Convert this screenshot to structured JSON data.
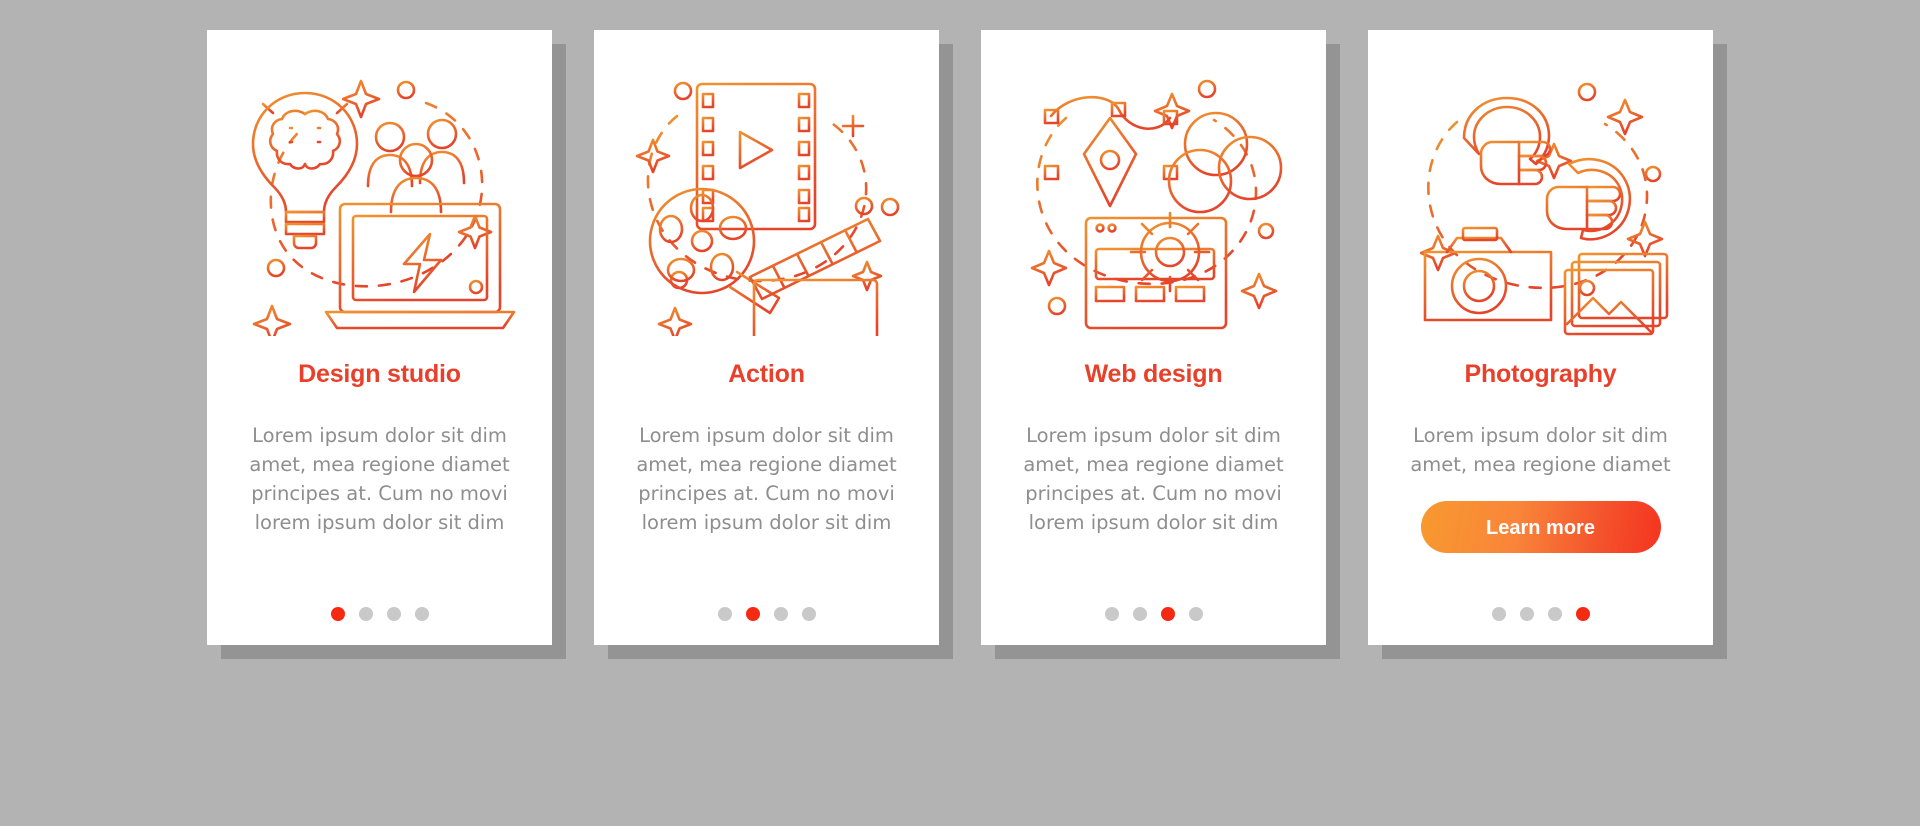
{
  "page": {
    "background_color": "#b3b3b3",
    "card_background": "#ffffff",
    "title_color": "#e8402a",
    "body_color": "#8e8e8e",
    "dot_active_color": "#f42a12",
    "dot_inactive_color": "#c9c9c9",
    "button_gradient_from": "#f8992e",
    "button_gradient_to": "#f5341f"
  },
  "cards": [
    {
      "id": "design-studio",
      "illustration": "lightbulb-brain-people-laptop-icon",
      "title": "Design studio",
      "body": "Lorem ipsum dolor sit dim amet, mea regione diamet principes at. Cum no movi lorem ipsum dolor sit dim",
      "has_button": false,
      "button_label": "",
      "dots": 4,
      "active_dot": 1
    },
    {
      "id": "action",
      "illustration": "film-strip-reel-clapperboard-icon",
      "title": "Action",
      "body": "Lorem ipsum dolor sit dim amet, mea regione diamet principes at. Cum no movi lorem ipsum dolor sit dim",
      "has_button": false,
      "button_label": "",
      "dots": 4,
      "active_dot": 2
    },
    {
      "id": "web-design",
      "illustration": "pen-tool-color-circles-gear-browser-icon",
      "title": "Web design",
      "body": "Lorem ipsum dolor sit dim amet, mea regione diamet principes at. Cum no movi lorem ipsum dolor sit dim",
      "has_button": false,
      "button_label": "",
      "dots": 4,
      "active_dot": 3
    },
    {
      "id": "photography",
      "illustration": "camera-photos-pointing-hands-icon",
      "title": "Photography",
      "body": "Lorem ipsum dolor sit dim amet, mea regione diamet",
      "has_button": true,
      "button_label": "Learn more",
      "dots": 4,
      "active_dot": 4
    }
  ]
}
